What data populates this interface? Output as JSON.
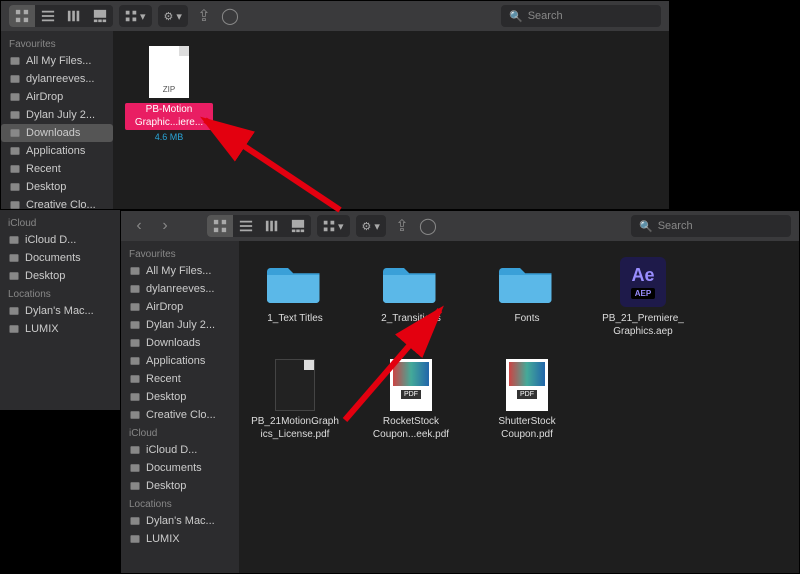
{
  "search_placeholder": "Search",
  "w1": {
    "sidebar": {
      "sections": [
        {
          "title": "Favourites",
          "items": [
            {
              "label": "All My Files..."
            },
            {
              "label": "dylanreeves..."
            },
            {
              "label": "AirDrop"
            },
            {
              "label": "Dylan July 2..."
            },
            {
              "label": "Downloads",
              "selected": true
            },
            {
              "label": "Applications"
            },
            {
              "label": "Recent"
            },
            {
              "label": "Desktop"
            },
            {
              "label": "Creative Clo..."
            }
          ]
        }
      ]
    },
    "file": {
      "name": "PB-Motion Graphic...iere...",
      "size": "4.6 MB",
      "ext": "ZIP"
    }
  },
  "w2": {
    "sidebar": {
      "sections": [
        {
          "title": "Favourites",
          "items": [
            {
              "label": "All My Files..."
            },
            {
              "label": "dylanreeves..."
            },
            {
              "label": "AirDrop"
            },
            {
              "label": "Dylan July 2..."
            },
            {
              "label": "Downloads"
            },
            {
              "label": "Applications"
            },
            {
              "label": "Recent"
            },
            {
              "label": "Desktop"
            },
            {
              "label": "Creative Clo..."
            }
          ]
        },
        {
          "title": "iCloud",
          "items": [
            {
              "label": "iCloud D..."
            },
            {
              "label": "Documents"
            },
            {
              "label": "Desktop"
            }
          ]
        },
        {
          "title": "Locations",
          "items": [
            {
              "label": "Dylan's Mac..."
            },
            {
              "label": "LUMIX"
            }
          ]
        }
      ]
    },
    "files": [
      {
        "type": "folder",
        "label": "1_Text Titles"
      },
      {
        "type": "folder",
        "label": "2_Transitions"
      },
      {
        "type": "folder",
        "label": "Fonts"
      },
      {
        "type": "aep",
        "label": "PB_21_Premiere_Graphics.aep"
      },
      {
        "type": "doc",
        "label": "PB_21MotionGraphics_License.pdf"
      },
      {
        "type": "pdf",
        "label": "RocketStock Coupon...eek.pdf"
      },
      {
        "type": "pdf",
        "label": "ShutterStock Coupon.pdf"
      }
    ]
  },
  "extra_sidebar": {
    "sections": [
      {
        "title": "iCloud",
        "items": [
          {
            "label": "iCloud D..."
          },
          {
            "label": "Documents"
          },
          {
            "label": "Desktop"
          }
        ]
      },
      {
        "title": "Locations",
        "items": [
          {
            "label": "Dylan's Mac..."
          },
          {
            "label": "LUMIX"
          }
        ]
      }
    ]
  },
  "aep_badge": "AEP",
  "ae_text": "Ae"
}
